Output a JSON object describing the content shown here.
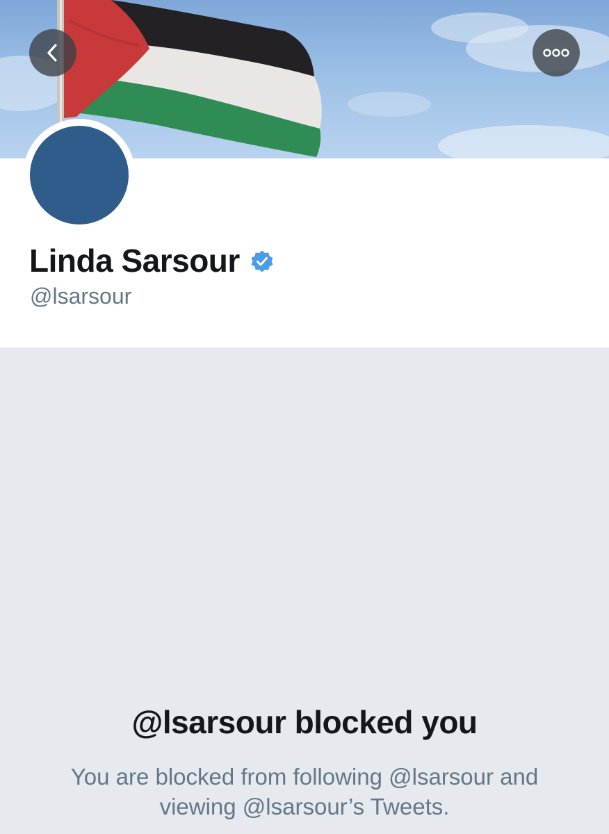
{
  "header": {
    "back_icon": "chevron-left-icon",
    "more_icon": "more-options-icon"
  },
  "profile": {
    "name": "Linda Sarsour",
    "handle": "@lsarsour",
    "verified_icon": "verified-badge-icon",
    "verified_color": "#4a9be8",
    "avatar_color": "#2f5c8a"
  },
  "blocked": {
    "title": "@lsarsour blocked you",
    "description": "You are blocked from following @lsarsour and viewing @lsarsour’s Tweets."
  },
  "colors": {
    "background": "#e6e9ee",
    "text_primary": "#14171a",
    "text_secondary": "#657786"
  }
}
